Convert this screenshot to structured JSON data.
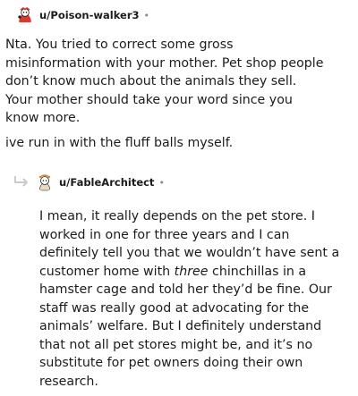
{
  "top_comment": {
    "username": "u/Poison-walker3",
    "separator": "•",
    "paragraphs": [
      "Nta. You tried to correct some gross misinformation with your mother. Pet shop people don’t know much about the animals they sell. Your mother should take your word since you know more.",
      "ive run in with the fluff balls myself."
    ]
  },
  "reply_comment": {
    "username": "u/FableArchitect",
    "separator": "•",
    "body_before_em": "I mean, it really depends on the pet store. I worked in one for three years and I can definitely tell you that we wouldn’t have sent a customer home with ",
    "body_em": "three",
    "body_after_em": " chinchillas in a hamster cage and told her they’d be fine. Our staff was really good at advocating for the animals’ welfare. But I definitely understand that not all pet stores might be, and it’s no substitute for pet owners doing their own research."
  },
  "icons": {
    "top_avatar": "snoo-avatar-icon",
    "reply_avatar": "snoo-avatar-icon",
    "reply_arrow": "reply-arrow-icon"
  },
  "colors": {
    "text": "#1c1c1c",
    "muted": "#878a8c",
    "avatar_red": "#d93a2b",
    "reply_arrow": "#c8cbcd"
  }
}
